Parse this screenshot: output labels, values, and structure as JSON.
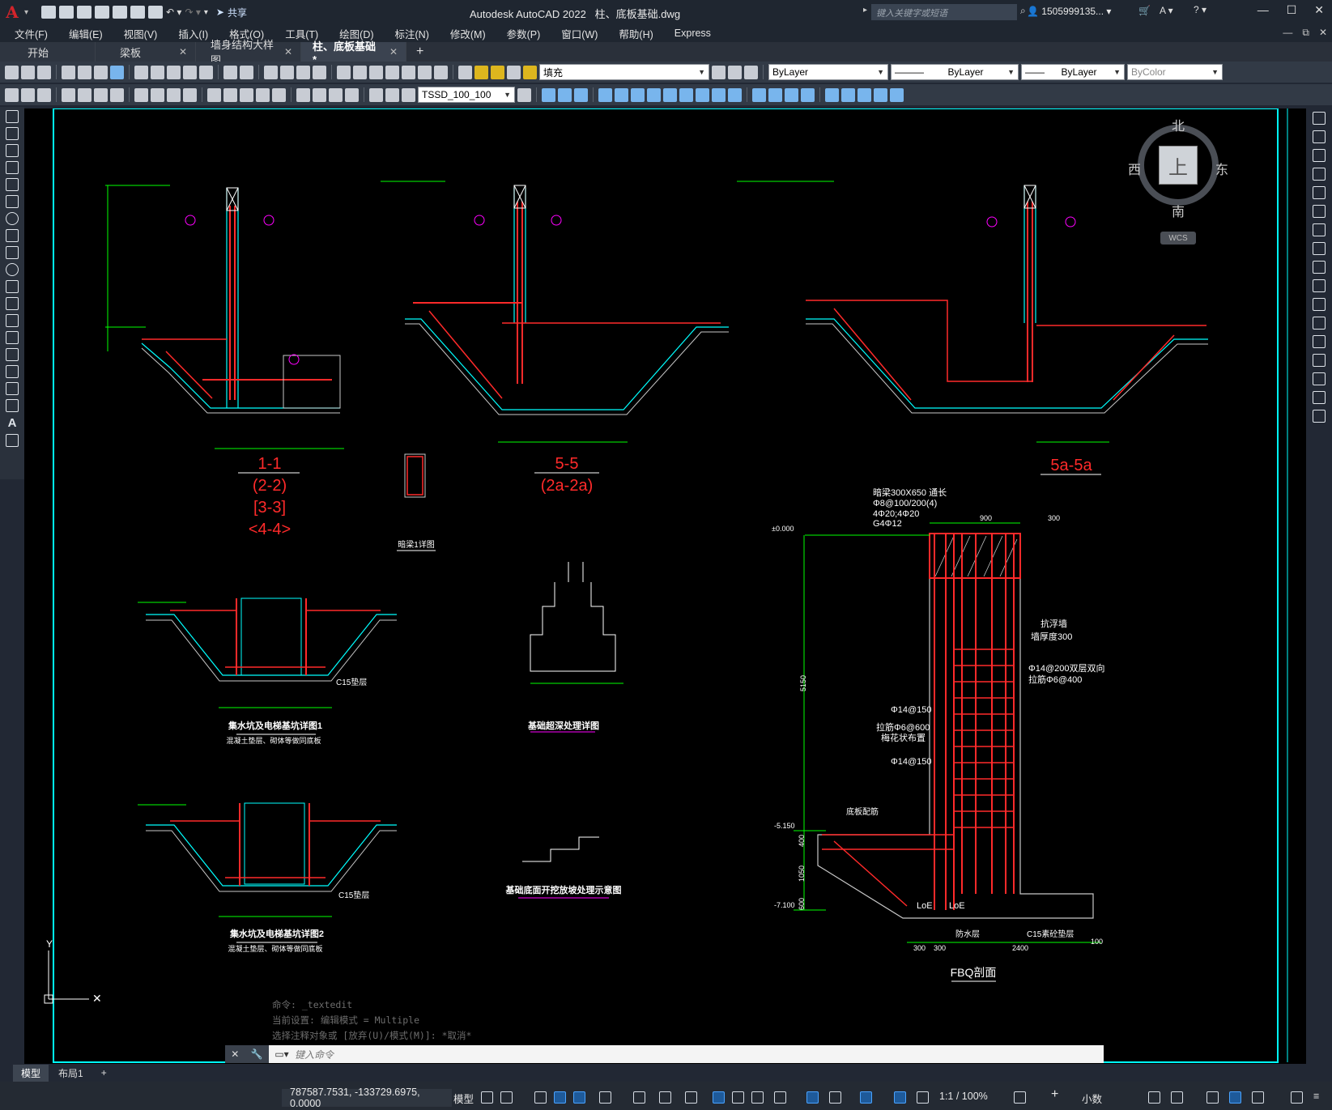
{
  "app": {
    "logo": "A",
    "title": "Autodesk AutoCAD 2022",
    "document": "柱、底板基础.dwg",
    "share_label": "共享",
    "search_placeholder": "键入关键字或短语",
    "user": "1505999135... ▾"
  },
  "menu": [
    "文件(F)",
    "编辑(E)",
    "视图(V)",
    "插入(I)",
    "格式(O)",
    "工具(T)",
    "绘图(D)",
    "标注(N)",
    "修改(M)",
    "参数(P)",
    "窗口(W)",
    "帮助(H)",
    "Express"
  ],
  "tabs": [
    {
      "label": "开始",
      "active": false
    },
    {
      "label": "梁板",
      "active": false
    },
    {
      "label": "墙身结构大样图",
      "active": false
    },
    {
      "label": "柱、底板基础*",
      "active": true
    }
  ],
  "toolbar": {
    "layer_value": "填充",
    "color_value": "ByLayer",
    "linetype_value": "ByLayer",
    "lineweight_value": "ByLayer",
    "plotstyle_value": "ByColor",
    "textstyle_value": "TSSD_100_100"
  },
  "viewcube": {
    "north": "北",
    "south": "南",
    "east": "东",
    "west": "西",
    "face": "上",
    "wcs": "WCS"
  },
  "drawing": {
    "sec1_title": "1-1",
    "sec1_sub1": "(2-2)",
    "sec1_sub2": "[3-3]",
    "sec1_sub3": "<4-4>",
    "sec5_title": "5-5",
    "sec5_sub": "(2a-2a)",
    "sec5a_title": "5a-5a",
    "anchor_detail": "暗梁1详图",
    "pit_detail1": "集水坑及电梯基坑详图1",
    "pit_detail1_note": "混凝土垫层、砌体等做同底板",
    "pit_detail2": "集水坑及电梯基坑详图2",
    "pit_detail2_note": "混凝土垫层、砌体等做同底板",
    "overdig_detail": "基础超深处理详图",
    "slope_detail": "基础底面开挖放坡处理示意图",
    "fbq_title": "FBQ剖面",
    "fbq_beam": "暗梁300X650 通长",
    "fbq_beam2": "Φ8@100/200(4)",
    "fbq_beam3": "4Φ20;4Φ20",
    "fbq_beam4": "G4Φ12",
    "fbq_wall": "抗浮墙",
    "fbq_wall2": "墙厚度300",
    "fbq_rebar": "Φ14@200双层双向",
    "fbq_tie": "拉筋Φ6@400",
    "fbq_r1": "Φ14@150",
    "fbq_r2": "拉筋Φ6@600",
    "fbq_r3": "梅花状布置",
    "fbq_r4": "Φ14@150",
    "fbq_base": "底板配筋",
    "fbq_c15": "C15素砼垫层",
    "fbq_waterproof": "防水层",
    "fbq_top": "±0.000",
    "fbq_lvl1": "-5.150",
    "fbq_lvl2": "-7.100",
    "fbq_dim1": "300",
    "fbq_dim2": "900",
    "fbq_dim3": "5150",
    "fbq_dim4": "2400",
    "fbq_dim5": "300",
    "fbq_dim6": "300",
    "fbq_dim7": "100",
    "fbq_dim8": "1050",
    "fbq_dim9": "600",
    "fbq_dim10": "400",
    "fbq_loe": "LoE",
    "c15": "C15垫层"
  },
  "command": {
    "history": [
      "命令: _textedit",
      "当前设置: 编辑模式 = Multiple",
      "选择注释对象或 [放弃(U)/模式(M)]: *取消*"
    ],
    "placeholder": "键入命令"
  },
  "layout_tabs": [
    {
      "label": "模型",
      "active": true
    },
    {
      "label": "布局1",
      "active": false
    }
  ],
  "status": {
    "coords": "787587.7531, -133729.6975, 0.0000",
    "model": "模型",
    "scale": "1:1 / 100%",
    "units": "小数"
  }
}
